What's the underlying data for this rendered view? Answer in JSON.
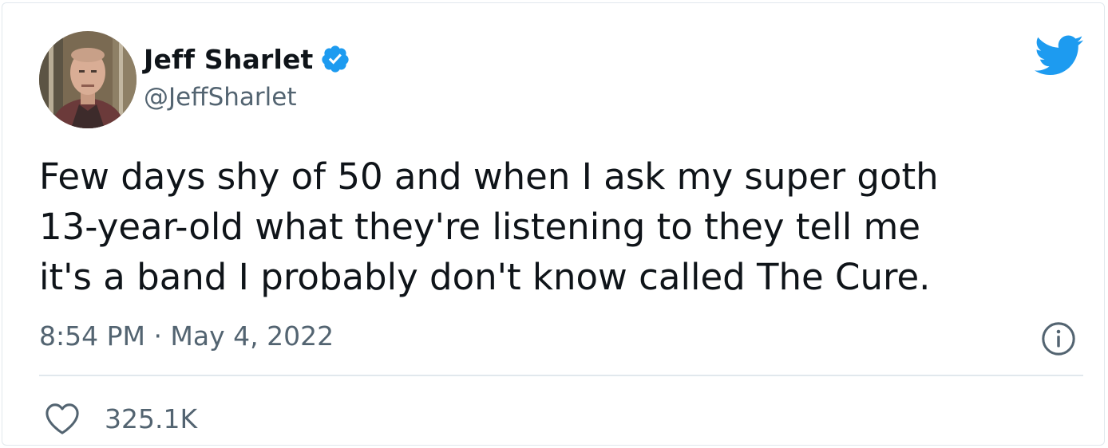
{
  "tweet": {
    "author": {
      "display_name": "Jeff Sharlet",
      "handle": "@JeffSharlet",
      "verified": true,
      "avatar": "profile-photo"
    },
    "text": "Few days shy of 50 and when I ask my super goth\n13-year-old what they're listening to they tell me\nit's a band I probably don't know called The Cure.",
    "timestamp": "8:54 PM · May 4, 2022",
    "likes": "325.1K"
  },
  "icons": {
    "verified": "verified-badge-icon",
    "brand": "twitter-bird-icon",
    "info": "info-icon",
    "like": "heart-icon"
  },
  "colors": {
    "brand_blue": "#1d9bf0",
    "text_primary": "#0f1419",
    "text_secondary": "#536471",
    "divider": "#e1e8ed"
  }
}
